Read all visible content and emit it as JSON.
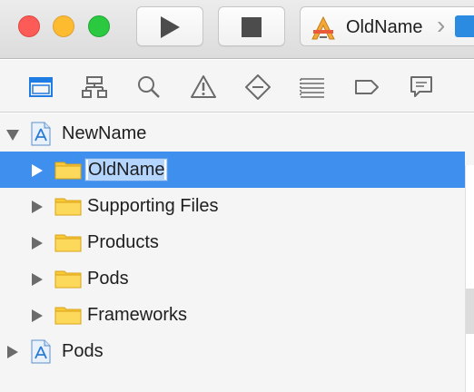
{
  "toolbar": {
    "scheme": {
      "name": "OldName"
    }
  },
  "navigator": {
    "tabs": [
      {
        "name": "project-navigator",
        "icon": "folder-icon",
        "selected": true
      },
      {
        "name": "symbol-navigator",
        "icon": "hierarchy-icon"
      },
      {
        "name": "find-navigator",
        "icon": "search-icon"
      },
      {
        "name": "issue-navigator",
        "icon": "warning-icon"
      },
      {
        "name": "test-navigator",
        "icon": "diamond-minus-icon"
      },
      {
        "name": "debug-navigator",
        "icon": "list-icon"
      },
      {
        "name": "breakpoint-navigator",
        "icon": "tag-icon"
      },
      {
        "name": "report-navigator",
        "icon": "speech-bubble-icon"
      }
    ]
  },
  "tree": {
    "items": [
      {
        "label": "NewName",
        "type": "project",
        "expanded": true,
        "level": 0
      },
      {
        "label": "OldName",
        "type": "folder",
        "level": 1,
        "selected": true,
        "editing": true
      },
      {
        "label": "Supporting Files",
        "type": "folder",
        "level": 1
      },
      {
        "label": "Products",
        "type": "folder",
        "level": 1
      },
      {
        "label": "Pods",
        "type": "folder",
        "level": 1
      },
      {
        "label": "Frameworks",
        "type": "folder",
        "level": 1
      },
      {
        "label": "Pods",
        "type": "project",
        "expanded": false,
        "level": 0
      }
    ]
  },
  "colors": {
    "selection": "#3e8fee",
    "folder": "#f8c93a",
    "accent_icon": "#2a8be0"
  }
}
